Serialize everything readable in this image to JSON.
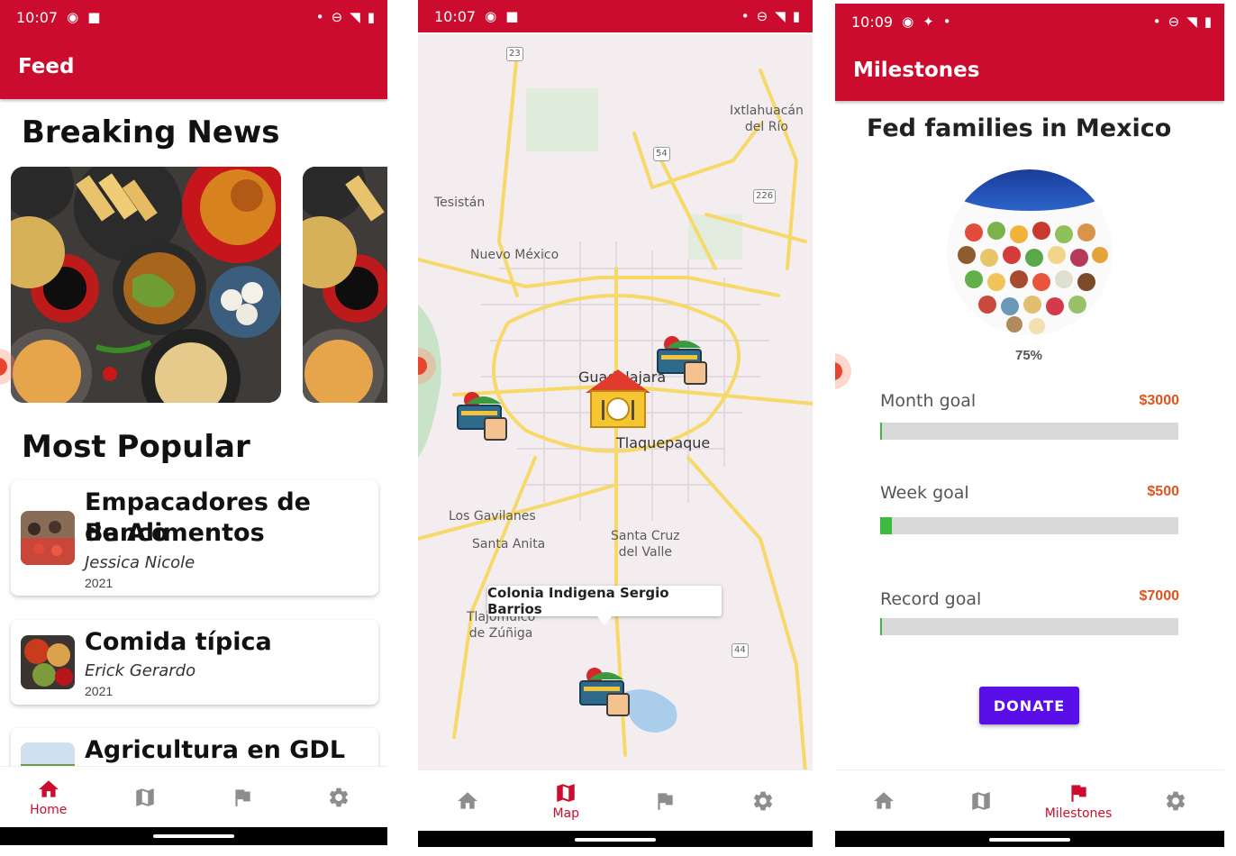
{
  "colors": {
    "primary": "#cc0c2e",
    "accent": "#5a0ee8",
    "goal_amount": "#e0531f",
    "progress": "#3dbb3f",
    "nav_inactive": "#8d8d8d"
  },
  "phone1": {
    "status": {
      "time": "10:07"
    },
    "appbar_title": "Feed",
    "breaking_news_title": "Breaking News",
    "most_popular_title": "Most Popular",
    "items": [
      {
        "title_line1": "Empacadores de Banco",
        "title_line2": "de Alimentos",
        "author": "Jessica Nicole",
        "year": "2021"
      },
      {
        "title_line1": "Comida típica",
        "author": "Erick Gerardo",
        "year": "2021"
      },
      {
        "title_line1": "Agricultura en GDL"
      }
    ],
    "nav": {
      "home": "Home"
    }
  },
  "phone2": {
    "status": {
      "time": "10:07"
    },
    "places": {
      "ixtlahuacan_1": "Ixtlahuacán",
      "ixtlahuacan_2": "del Río",
      "tesistan": "Tesistán",
      "nuevo_mexico": "Nuevo México",
      "guadalajara": "Guadalajara",
      "tlaquepaque": "Tlaquepaque",
      "los_gavilanes": "Los Gavilanes",
      "santa_anita": "Santa Anita",
      "santa_cruz_1": "Santa Cruz",
      "santa_cruz_2": "del Valle",
      "tlajomulco_1": "Tlajomulco",
      "tlajomulco_2": "de Zúñiga"
    },
    "shields": [
      "23",
      "54",
      "226",
      "44"
    ],
    "tooltip": "Colonia Indigena Sergio Barrios",
    "nav": {
      "map": "Map"
    }
  },
  "phone3": {
    "status": {
      "time": "10:09"
    },
    "appbar_title": "Milestones",
    "section_title": "Fed families in Mexico",
    "percent_label": "75%",
    "percent_value": 0.75,
    "goals": [
      {
        "label": "Month goal",
        "amount": "$3000",
        "progress": 0.005
      },
      {
        "label": "Week goal",
        "amount": "$500",
        "progress": 0.04
      },
      {
        "label": "Record goal",
        "amount": "$7000",
        "progress": 0.004
      }
    ],
    "donate_label": "DONATE",
    "nav": {
      "milestones": "Milestones"
    }
  }
}
